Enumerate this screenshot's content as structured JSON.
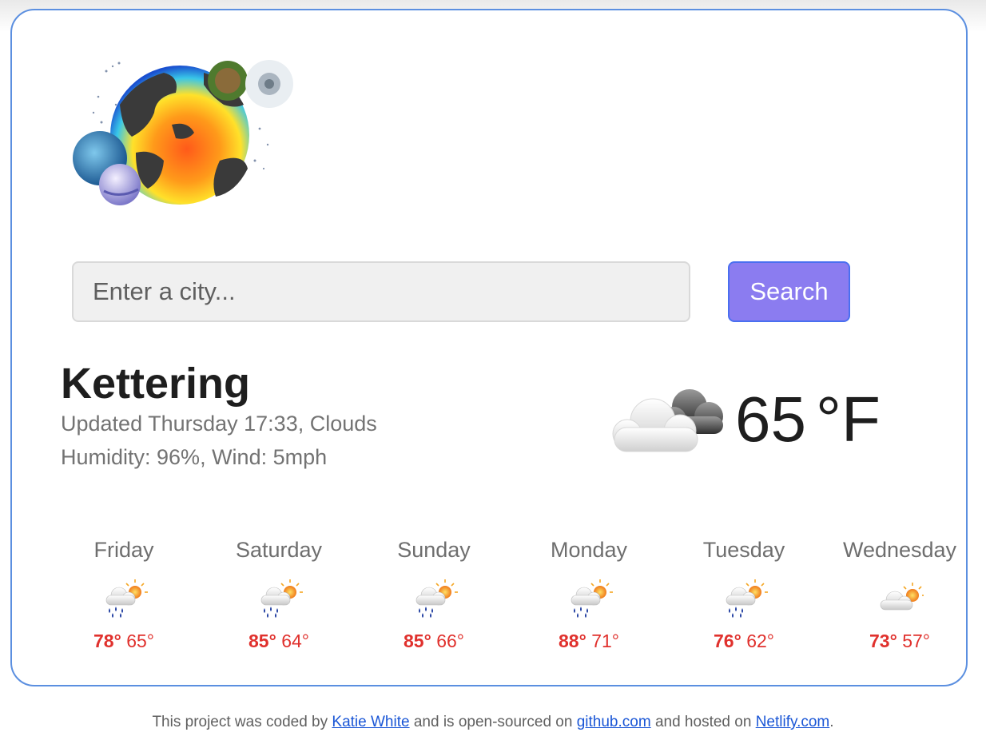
{
  "search": {
    "placeholder": "Enter a city...",
    "button_label": "Search"
  },
  "current": {
    "city": "Kettering",
    "updated": "Updated Thursday 17:33, Clouds",
    "details": "Humidity: 96%, Wind: 5mph",
    "temperature": "65",
    "unit": "°F",
    "icon": "broken-clouds-icon"
  },
  "forecast": [
    {
      "day": "Friday",
      "max": "78°",
      "min": "65°",
      "icon": "rain-sun-icon"
    },
    {
      "day": "Saturday",
      "max": "85°",
      "min": "64°",
      "icon": "rain-sun-icon"
    },
    {
      "day": "Sunday",
      "max": "85°",
      "min": "66°",
      "icon": "rain-sun-icon"
    },
    {
      "day": "Monday",
      "max": "88°",
      "min": "71°",
      "icon": "rain-sun-icon"
    },
    {
      "day": "Tuesday",
      "max": "76°",
      "min": "62°",
      "icon": "rain-sun-icon"
    },
    {
      "day": "Wednesday",
      "max": "73°",
      "min": "57°",
      "icon": "partly-cloudy-icon"
    }
  ],
  "footer": {
    "text_1": "This project was coded by",
    "link_author": "Katie White",
    "text_2": "and is open-sourced on",
    "link_github": "github.com",
    "text_3": "and hosted on",
    "link_netlify": "Netlify.com",
    "text_4": "."
  },
  "colors": {
    "card_border": "#5b8fe0",
    "button_bg": "#8b7cf0",
    "temp_red": "#e0312d",
    "link": "#1a56d6"
  }
}
